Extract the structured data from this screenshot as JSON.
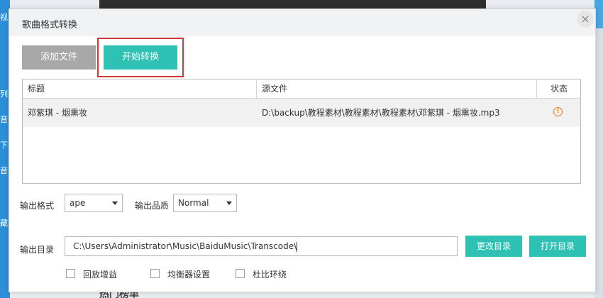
{
  "dialog": {
    "title": "歌曲格式转换",
    "close_glyph": "×"
  },
  "toolbar": {
    "add_file_label": "添加文件",
    "start_convert_label": "开始转换"
  },
  "table": {
    "columns": [
      "标题",
      "源文件",
      "状态"
    ],
    "rows": [
      {
        "title": "邓紫琪 - 烟熏妆",
        "source": "D:\\backup\\教程素材\\教程素材\\教程素材\\邓紫琪  -  烟熏妆.mp3",
        "status_icon": "warning-icon"
      }
    ]
  },
  "output": {
    "format_label": "输出格式",
    "format_value": "ape",
    "quality_label": "输出品质",
    "quality_value": "Normal",
    "dir_label": "输出目录",
    "dir_value": "C:\\Users\\Administrator\\Music\\BaiduMusic\\Transcode\\",
    "change_dir_label": "更改目录",
    "open_dir_label": "打开目录"
  },
  "options": [
    {
      "label": "回放增益"
    },
    {
      "label": "均衡器设置"
    },
    {
      "label": "杜比环绕"
    }
  ],
  "background": {
    "left_chars": [
      "视",
      "列",
      "音",
      "下",
      "音",
      "藏"
    ],
    "bottom_text": "热门榜单"
  },
  "colors": {
    "accent_teal": "#2ec1b4",
    "disabled_gray": "#a8a8a8",
    "highlight_red": "#d23a3a",
    "warning_orange": "#e57c2a"
  }
}
